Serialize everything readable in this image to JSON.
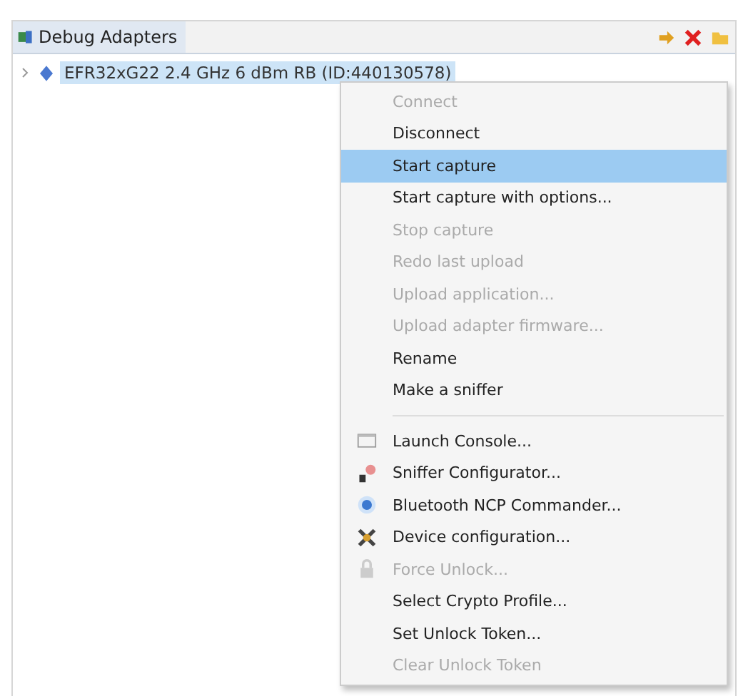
{
  "panel": {
    "tab": "Debug Adapters"
  },
  "tree": [
    {
      "label": "EFR32xG22 2.4 GHz 6 dBm RB (ID:440130578)",
      "expanded": false,
      "selected": true
    }
  ],
  "context_menu": [
    {
      "kind": "item",
      "label": "Connect",
      "disabled": true,
      "selected": false
    },
    {
      "kind": "item",
      "label": "Disconnect",
      "disabled": false,
      "selected": false
    },
    {
      "kind": "item",
      "label": "Start capture",
      "disabled": false,
      "selected": true
    },
    {
      "kind": "item",
      "label": "Start capture with options...",
      "disabled": false,
      "selected": false
    },
    {
      "kind": "item",
      "label": "Stop capture",
      "disabled": true,
      "selected": false
    },
    {
      "kind": "item",
      "label": "Redo last upload",
      "disabled": true,
      "selected": false
    },
    {
      "kind": "item",
      "label": "Upload application...",
      "disabled": true,
      "selected": false
    },
    {
      "kind": "item",
      "label": "Upload adapter firmware...",
      "disabled": true,
      "selected": false
    },
    {
      "kind": "item",
      "label": "Rename",
      "disabled": false,
      "selected": false
    },
    {
      "kind": "item",
      "label": "Make a sniffer",
      "disabled": false,
      "selected": false
    },
    {
      "kind": "separator"
    },
    {
      "kind": "item",
      "label": "Launch Console...",
      "disabled": false,
      "selected": false
    },
    {
      "kind": "item",
      "label": "Sniffer Configurator...",
      "disabled": false,
      "selected": false
    },
    {
      "kind": "item",
      "label": "Bluetooth NCP Commander...",
      "disabled": false,
      "selected": false
    },
    {
      "kind": "item",
      "label": "Device configuration...",
      "disabled": false,
      "selected": false
    },
    {
      "kind": "item",
      "label": "Force Unlock...",
      "disabled": true,
      "selected": false
    },
    {
      "kind": "item",
      "label": "Select Crypto Profile...",
      "disabled": false,
      "selected": false
    },
    {
      "kind": "item",
      "label": "Set Unlock Token...",
      "disabled": false,
      "selected": false
    },
    {
      "kind": "item",
      "label": "Clear Unlock Token",
      "disabled": true,
      "selected": false
    }
  ]
}
